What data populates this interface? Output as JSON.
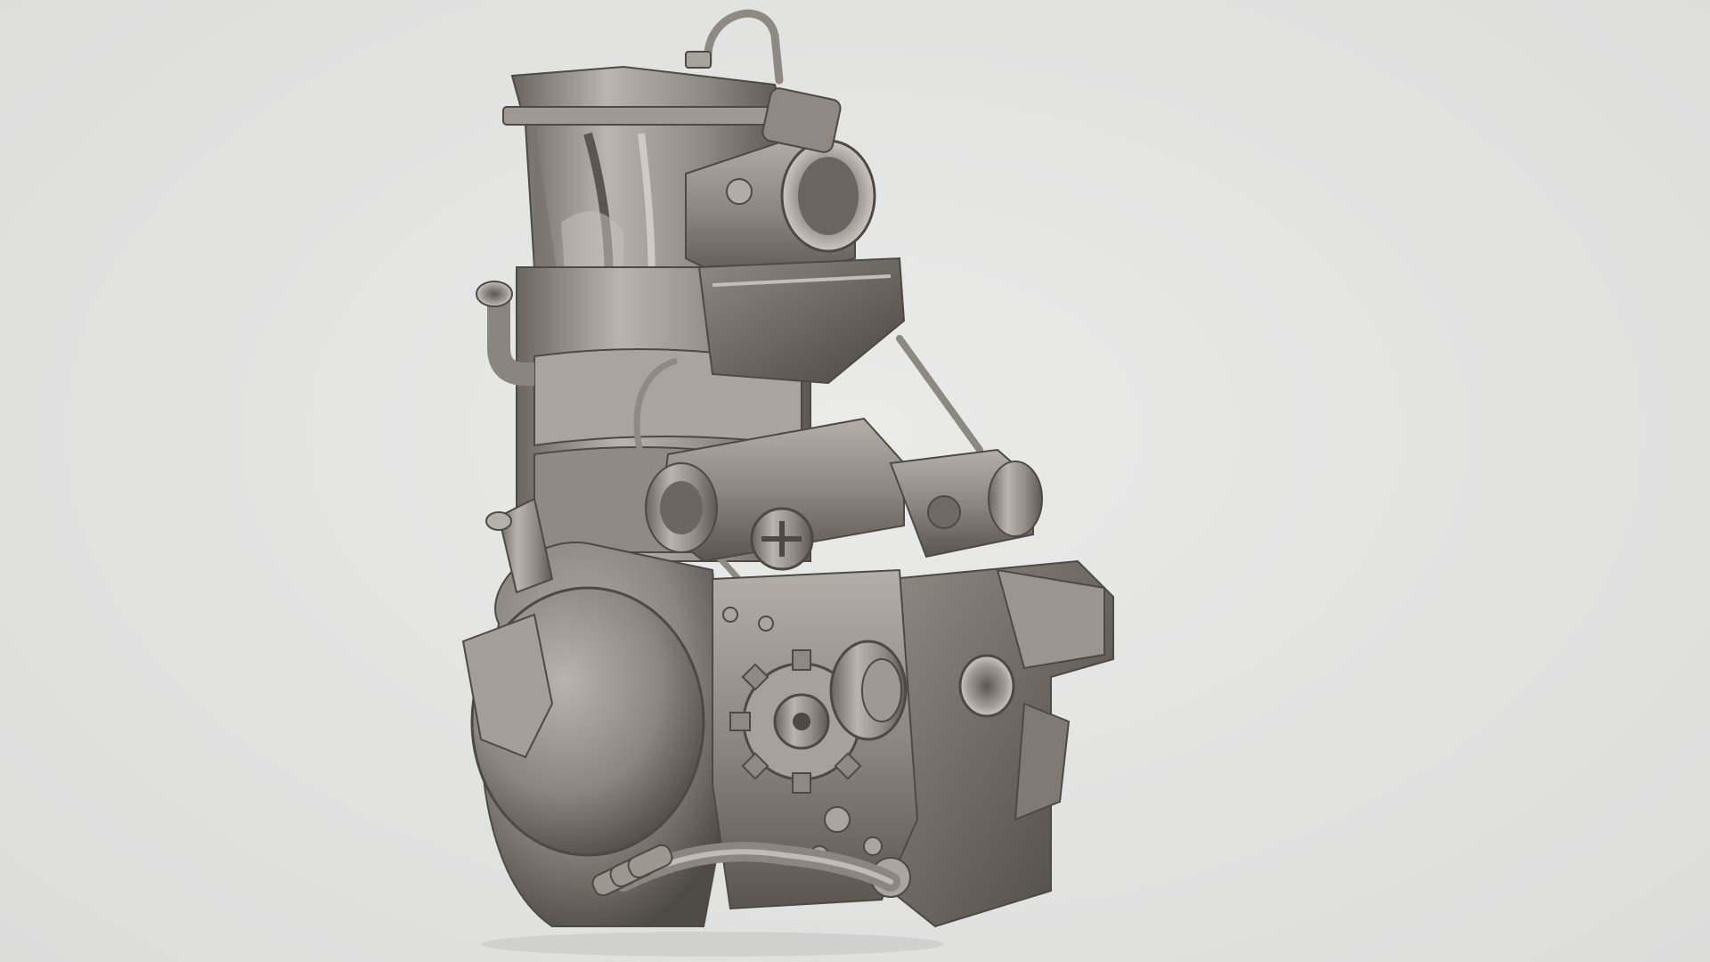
{
  "scene": {
    "background_color": "#e3e3e2",
    "subject": "engine-model",
    "material_color": "#8a8580"
  }
}
